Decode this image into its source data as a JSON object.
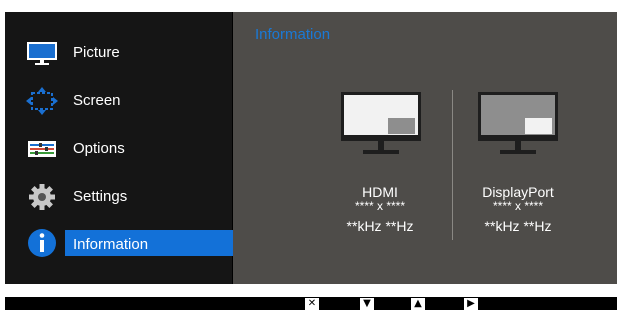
{
  "menu": {
    "items": [
      {
        "label": "Picture",
        "icon": "monitor-icon"
      },
      {
        "label": "Screen",
        "icon": "screen-resize-icon"
      },
      {
        "label": "Options",
        "icon": "options-sliders-icon"
      },
      {
        "label": "Settings",
        "icon": "gear-icon"
      },
      {
        "label": "Information",
        "icon": "info-icon",
        "selected": true
      }
    ]
  },
  "content": {
    "title": "Information",
    "sources": [
      {
        "name": "HDMI",
        "resolution": "**** x ****",
        "frequency": "**kHz **Hz"
      },
      {
        "name": "DisplayPort",
        "resolution": "**** x ****",
        "frequency": "**kHz **Hz"
      }
    ]
  },
  "bottom_bar": {
    "buttons": [
      {
        "glyph": "✕",
        "icon": "close-icon"
      },
      {
        "glyph": "▼",
        "icon": "arrow-down-icon"
      },
      {
        "glyph": "▲",
        "icon": "arrow-up-icon"
      },
      {
        "glyph": "▶",
        "icon": "arrow-right-icon"
      }
    ]
  },
  "colors": {
    "accent": "#1371d8",
    "title": "#1a79d6",
    "panel": "#4e4c49",
    "sidebar": "#151515"
  }
}
